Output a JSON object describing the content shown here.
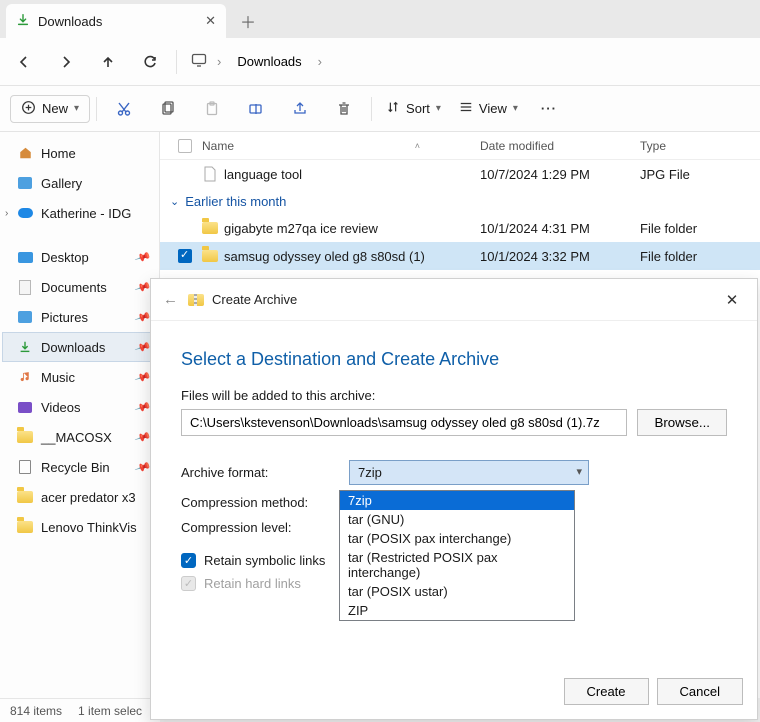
{
  "tab": {
    "title": "Downloads"
  },
  "breadcrumb": {
    "current": "Downloads"
  },
  "toolbar": {
    "new": "New",
    "sort": "Sort",
    "view": "View"
  },
  "columns": {
    "name": "Name",
    "date": "Date modified",
    "type": "Type"
  },
  "group": {
    "label": "Earlier this month"
  },
  "files": [
    {
      "name": "language tool",
      "date": "10/7/2024 1:29 PM",
      "type": "JPG File",
      "kind": "file"
    },
    {
      "name": "gigabyte m27qa ice review",
      "date": "10/1/2024 4:31 PM",
      "type": "File folder",
      "kind": "folder"
    },
    {
      "name": "samsug odyssey oled g8 s80sd (1)",
      "date": "10/1/2024 3:32 PM",
      "type": "File folder",
      "kind": "folder"
    }
  ],
  "sidebar": {
    "main": [
      {
        "label": "Home"
      },
      {
        "label": "Gallery"
      },
      {
        "label": "Katherine - IDG"
      }
    ],
    "pinned": [
      {
        "label": "Desktop"
      },
      {
        "label": "Documents"
      },
      {
        "label": "Pictures"
      },
      {
        "label": "Downloads"
      },
      {
        "label": "Music"
      },
      {
        "label": "Videos"
      },
      {
        "label": "__MACOSX"
      },
      {
        "label": "Recycle Bin"
      },
      {
        "label": "acer predator x3"
      },
      {
        "label": "Lenovo ThinkVis"
      }
    ]
  },
  "status": {
    "items": "814 items",
    "selected": "1 item selec"
  },
  "dialog": {
    "crumb": "Create Archive",
    "heading": "Select a Destination and Create Archive",
    "path_label": "Files will be added to this archive:",
    "path_value": "C:\\Users\\kstevenson\\Downloads\\samsug odyssey oled g8 s80sd (1).7z",
    "browse": "Browse...",
    "format_label": "Archive format:",
    "compression_method_label": "Compression method:",
    "compression_level_label": "Compression level:",
    "format_selected": "7zip",
    "format_options": [
      "7zip",
      "tar (GNU)",
      "tar (POSIX pax interchange)",
      "tar (Restricted POSIX pax interchange)",
      "tar (POSIX ustar)",
      "ZIP"
    ],
    "retain_symlinks": "Retain symbolic links",
    "retain_hardlinks": "Retain hard links",
    "create": "Create",
    "cancel": "Cancel"
  }
}
